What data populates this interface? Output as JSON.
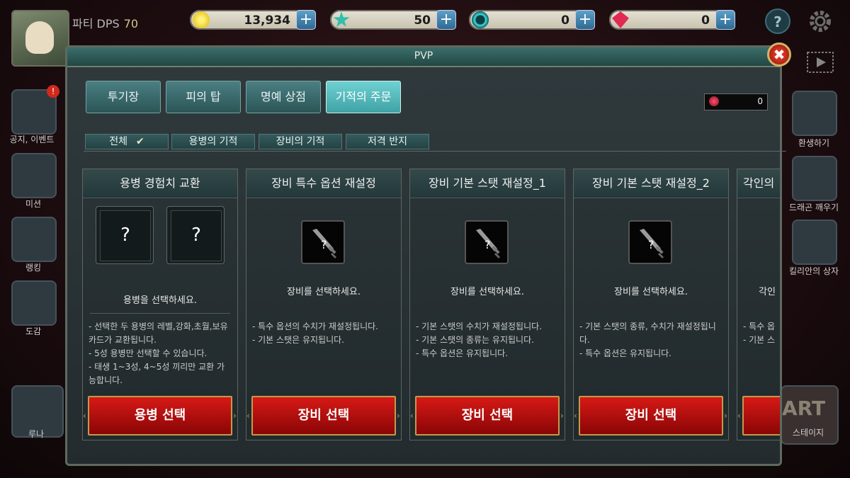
{
  "hud": {
    "party_dps_label": "파티 DPS",
    "party_dps_value": "70",
    "currencies": [
      {
        "name": "gold",
        "value": "13,934",
        "color": "#f2d21a"
      },
      {
        "name": "star-gem",
        "value": "50",
        "color": "#3cc6b4"
      },
      {
        "name": "cyan-orb",
        "value": "0",
        "color": "#2bc1c6"
      },
      {
        "name": "red-crystal",
        "value": "0",
        "color": "#e42c4d"
      }
    ],
    "plus_label": "+",
    "help_label": "?"
  },
  "left_menu": [
    {
      "label": "공지, 이벤트",
      "badge": "!"
    },
    {
      "label": "미션"
    },
    {
      "label": "랭킹"
    },
    {
      "label": "도감"
    },
    {
      "label": "루나"
    }
  ],
  "right_menu": [
    {
      "label": "환생하기"
    },
    {
      "label": "드래곤 깨우기"
    },
    {
      "label": "킬리안의 상자"
    },
    {
      "label": "스테이지",
      "big": "ART"
    }
  ],
  "panel": {
    "title": "PVP",
    "close_label": "✖",
    "tabs": [
      "투기장",
      "피의 탑",
      "명예 상점",
      "기적의 주문"
    ],
    "active_tab": 3,
    "token_value": "0",
    "filters": [
      "전체",
      "용병의 기적",
      "장비의 기적",
      "저격 반지"
    ],
    "filter_check": "✔",
    "cards": [
      {
        "title": "용병 경험치 교환",
        "slots": [
          "?",
          "?"
        ],
        "prompt": "용병을 선택하세요.",
        "desc": [
          "- 선택한 두 용병의 레벨,강화,초월,보유 카드가 교환됩니다.",
          "- 5성 용병만 선택할 수 있습니다.",
          "- 태생 1~3성, 4~5성 끼리만 교환 가능합니다."
        ],
        "button": "용병 선택"
      },
      {
        "title": "장비 특수 옵션 재설정",
        "prompt": "장비를 선택하세요.",
        "desc": [
          "- 특수 옵션의 수치가 재설정됩니다.",
          "- 기본 스탯은 유지됩니다."
        ],
        "button": "장비 선택"
      },
      {
        "title": "장비 기본 스탯 재설정_1",
        "prompt": "장비를 선택하세요.",
        "desc": [
          "- 기본 스탯의 수치가 재설정됩니다.",
          "- 기본 스탯의 종류는 유지됩니다.",
          "- 특수 옵션은 유지됩니다."
        ],
        "button": "장비 선택"
      },
      {
        "title": "장비 기본 스탯 재설정_2",
        "prompt": "장비를 선택하세요.",
        "desc": [
          "- 기본 스탯의 종류, 수치가 재설정됩니다.",
          "- 특수 옵션은 유지됩니다."
        ],
        "button": "장비 선택"
      },
      {
        "title": "각인의",
        "prompt": "각인",
        "desc": [
          "- 특수 옵",
          "- 기본 스"
        ],
        "button": ""
      }
    ],
    "arrow_left": "‹",
    "arrow_right": "›"
  }
}
